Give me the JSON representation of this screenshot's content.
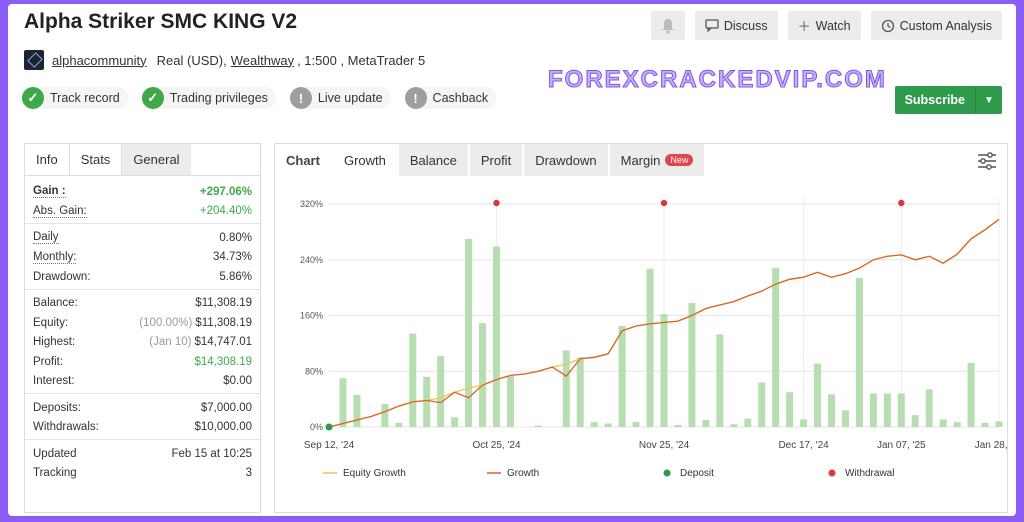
{
  "header": {
    "title": "Alpha Striker SMC KING V2",
    "owner": "alphacommunity",
    "account_type": "Real (USD),",
    "broker": "Wealthway",
    "leverage_platform": ", 1:500 , MetaTrader 5"
  },
  "badges": [
    {
      "label": "Track record",
      "status": "ok"
    },
    {
      "label": "Trading privileges",
      "status": "ok"
    },
    {
      "label": "Live update",
      "status": "warn"
    },
    {
      "label": "Cashback",
      "status": "warn"
    }
  ],
  "watermark": "FOREXCRACKEDVIP.COM",
  "actions": {
    "discuss": "Discuss",
    "watch": "Watch",
    "custom_analysis": "Custom Analysis"
  },
  "subscribe": {
    "label": "Subscribe"
  },
  "left_tabs": [
    "Info",
    "Stats",
    "General"
  ],
  "stats": {
    "gain": {
      "label": "Gain :",
      "value": "+297.06%"
    },
    "abs_gain": {
      "label": "Abs. Gain:",
      "value": "+204.40%"
    },
    "daily": {
      "label": "Daily",
      "value": "0.80%"
    },
    "monthly": {
      "label": "Monthly:",
      "value": "34.73%"
    },
    "drawdown": {
      "label": "Drawdown:",
      "value": "5.86%"
    },
    "balance": {
      "label": "Balance:",
      "value": "$11,308.19"
    },
    "equity": {
      "label": "Equity:",
      "sub": "(100.00%)",
      "value": "$11,308.19"
    },
    "highest": {
      "label": "Highest:",
      "sub": "(Jan 10)",
      "value": "$14,747.01"
    },
    "profit": {
      "label": "Profit:",
      "value": "$14,308.19"
    },
    "interest": {
      "label": "Interest:",
      "value": "$0.00"
    },
    "deposits": {
      "label": "Deposits:",
      "value": "$7,000.00"
    },
    "withdrawals": {
      "label": "Withdrawals:",
      "value": "$10,000.00"
    },
    "updated": {
      "label": "Updated",
      "value": "Feb 15 at 10:25"
    },
    "tracking": {
      "label": "Tracking",
      "value": "3"
    }
  },
  "right_tabs": [
    "Chart",
    "Growth",
    "Balance",
    "Profit",
    "Drawdown",
    "Margin"
  ],
  "new_badge": "New",
  "colors": {
    "green": "#3fa949",
    "bar": "#b6deb0",
    "growth": "#d9642c",
    "equity": "#f0c64b",
    "withdrawal": "#d63a3a",
    "deposit": "#2e9a4c"
  },
  "chart_data": {
    "type": "bar",
    "y_ticks": [
      "320%",
      "240%",
      "160%",
      "80%",
      "0%"
    ],
    "ylim": [
      0,
      320
    ],
    "x_ticks": [
      "Sep 12, '24",
      "Oct 25, '24",
      "Nov 25, '24",
      "Dec 17, '24",
      "Jan 07, '25",
      "Jan 28, '25"
    ],
    "bars": [
      0,
      70,
      46,
      0,
      33,
      6,
      134,
      72,
      102,
      14,
      270,
      149,
      259,
      73,
      0,
      2,
      0,
      110,
      100,
      7,
      5,
      145,
      7,
      227,
      162,
      3,
      178,
      10,
      133,
      4,
      12,
      64,
      228,
      50,
      11,
      91,
      47,
      24,
      214,
      48,
      48,
      48,
      17,
      54,
      11,
      7,
      92,
      6,
      8
    ],
    "series": [
      {
        "name": "Equity Growth",
        "values": [
          0,
          5,
          10,
          15,
          22,
          30,
          36,
          38,
          42,
          50,
          56,
          60,
          68,
          74,
          76,
          80,
          86,
          90,
          98,
          100,
          105,
          138,
          145,
          148,
          150,
          152,
          160,
          170,
          175,
          180,
          188,
          195,
          205,
          212,
          215,
          222,
          215,
          220,
          228,
          240,
          245,
          247,
          240,
          245,
          235,
          248,
          270,
          283,
          298
        ]
      },
      {
        "name": "Growth",
        "values": [
          0,
          5,
          10,
          15,
          22,
          30,
          36,
          38,
          35,
          50,
          42,
          60,
          68,
          74,
          76,
          80,
          86,
          73,
          98,
          100,
          105,
          138,
          145,
          148,
          150,
          152,
          160,
          170,
          175,
          180,
          188,
          195,
          205,
          212,
          215,
          222,
          215,
          220,
          228,
          240,
          245,
          247,
          240,
          245,
          235,
          248,
          270,
          283,
          298
        ]
      }
    ],
    "deposit_points": [
      {
        "x_index": 0,
        "y": 0
      }
    ],
    "withdrawal_points": [
      12,
      24,
      41
    ],
    "legend": [
      "Equity Growth",
      "Growth",
      "Deposit",
      "Withdrawal"
    ]
  }
}
